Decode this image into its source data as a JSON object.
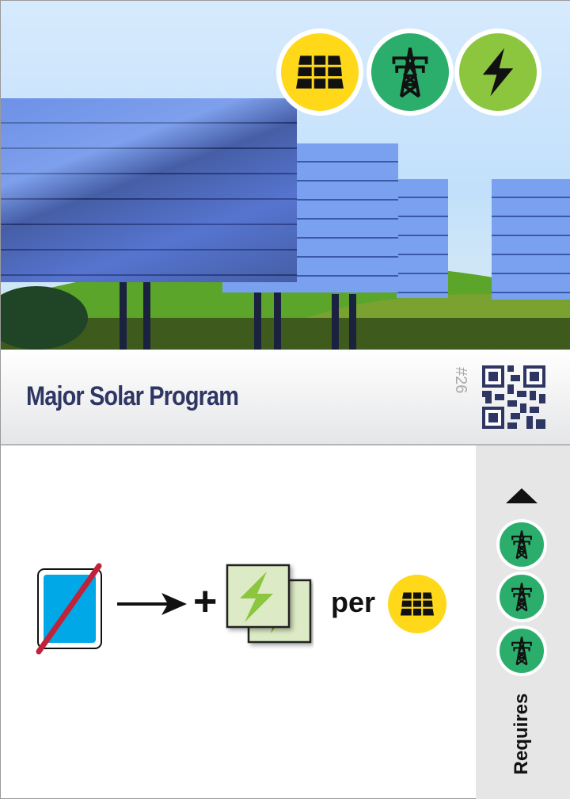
{
  "card": {
    "title": "Major Solar Program",
    "number": "#26",
    "top_icons": [
      "solar-panel-icon",
      "power-pylon-icon",
      "lightning-icon"
    ],
    "effect": {
      "plus": "+",
      "per": "per"
    },
    "requires_label": "Requires",
    "requires_icons": [
      "power-pylon-icon",
      "power-pylon-icon",
      "power-pylon-icon"
    ]
  },
  "colors": {
    "solar": "#ffd81a",
    "grid": "#2bae6c",
    "energy": "#8cc63f",
    "title": "#2e3663",
    "card_blue": "#00a8e8",
    "strike": "#c0223a"
  }
}
